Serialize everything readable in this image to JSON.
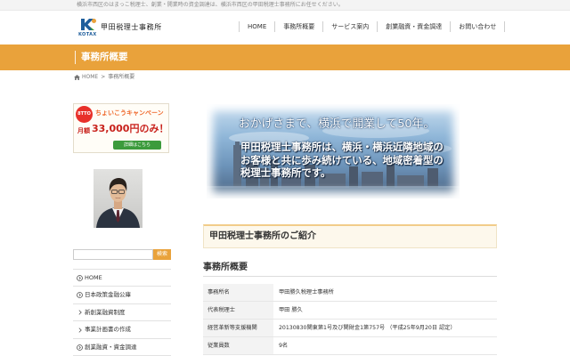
{
  "top_bar": {
    "tagline": "横浜市西区のはまっこ税理士、創業・開業時の資金調達は、横浜市西区の甲田税理士事務所にお任せください。"
  },
  "header": {
    "logo_mark": "KOTAX",
    "logo_text": "甲田税理士事務所",
    "nav": [
      {
        "label": "HOME"
      },
      {
        "label": "事務所概要"
      },
      {
        "label": "サービス案内"
      },
      {
        "label": "創業融資・資金調達"
      },
      {
        "label": "お問い合わせ"
      }
    ]
  },
  "page_banner": {
    "title": "事務所概要"
  },
  "breadcrumb": {
    "icon": "home-icon",
    "home": "HOME",
    "separator": ">",
    "current": "事務所概要"
  },
  "sidebar": {
    "campaign": {
      "badge": "8TTO",
      "title": "ちょいこうキャンペーン",
      "price_prefix": "月額",
      "price": "33,000円のみ！",
      "button": "詳細はこちら"
    },
    "search": {
      "button": "検索"
    },
    "menu": [
      {
        "label": "HOME",
        "icon": "circle-chevron-icon"
      },
      {
        "label": "日本政策金融公庫",
        "icon": "circle-chevron-icon"
      },
      {
        "label": "新創業融資制度",
        "icon": "chevron-right-icon"
      },
      {
        "label": "事業計画書の作成",
        "icon": "chevron-right-icon"
      },
      {
        "label": "創業融資・資金調達",
        "icon": "circle-chevron-icon"
      }
    ]
  },
  "main": {
    "hero": {
      "headline": "おかげさまで、横浜で開業して50年。",
      "body_lines": [
        "甲田税理士事務所は、横浜・横浜近隣地域の",
        "お客様と共に歩み続けている、地域密着型の",
        "税理士事務所です。"
      ]
    },
    "intro_heading": "甲田税理士事務所のご紹介",
    "overview_heading": "事務所概要",
    "table": [
      {
        "label": "事務所名",
        "value": "甲田勝久税理士事務所"
      },
      {
        "label": "代表税理士",
        "value": "甲田 勝久"
      },
      {
        "label": "経営革新等支援機関",
        "value": "20130830関東第1号及び関財金1第757号 （平成25年9月20日 認定）"
      },
      {
        "label": "従業員数",
        "value": "9名"
      }
    ]
  },
  "colors": {
    "accent": "#e9a23b",
    "campaign_red": "#c8211b",
    "campaign_orange": "#ef6a2e",
    "button_green": "#3c9b3c"
  }
}
